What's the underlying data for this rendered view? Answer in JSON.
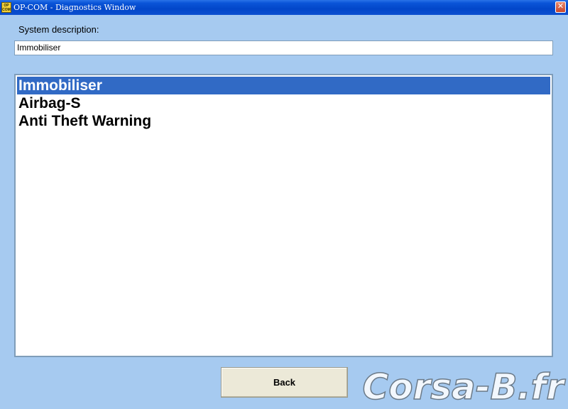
{
  "window": {
    "title": "OP-COM - Diagnostics Window",
    "icon_text": "OP COM",
    "close_symbol": "✕"
  },
  "system_description": {
    "label": "System description:",
    "value": "Immobiliser"
  },
  "list": {
    "items": [
      {
        "label": "Immobiliser",
        "selected": true
      },
      {
        "label": "Airbag-S",
        "selected": false
      },
      {
        "label": "Anti Theft Warning",
        "selected": false
      }
    ]
  },
  "buttons": {
    "back_label": "Back"
  },
  "watermark": {
    "text": "Corsa-B.fr"
  },
  "colors": {
    "background": "#a6caf0",
    "selection": "#316ac5",
    "titlebar": "#0a55d8"
  }
}
